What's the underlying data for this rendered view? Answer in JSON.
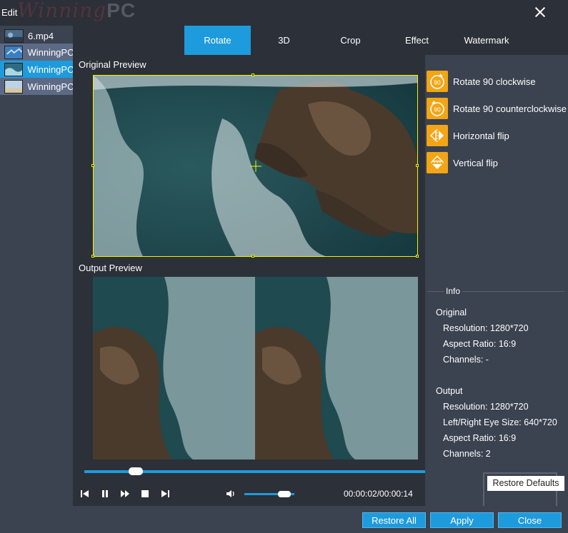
{
  "window": {
    "title": "Edit",
    "logo_text": "Winning",
    "logo_pc": "PC"
  },
  "files": [
    {
      "name": "6.mp4"
    },
    {
      "name": "WinningPC"
    },
    {
      "name": "WinningPC"
    },
    {
      "name": "WinningPC"
    }
  ],
  "tabs": [
    {
      "label": "Rotate"
    },
    {
      "label": "3D"
    },
    {
      "label": "Crop"
    },
    {
      "label": "Effect"
    },
    {
      "label": "Watermark"
    }
  ],
  "preview": {
    "original_label": "Original Preview",
    "output_label": "Output Preview",
    "progress_fraction": 0.15
  },
  "player": {
    "timecode": "00:00:02/00:00:14",
    "volume_fraction": 0.8
  },
  "rotate_actions": [
    {
      "label": "Rotate 90 clockwise",
      "icon": "rotate-clockwise-icon"
    },
    {
      "label": "Rotate 90 counterclockwise",
      "icon": "rotate-counterclockwise-icon"
    },
    {
      "label": "Horizontal flip",
      "icon": "horizontal-flip-icon"
    },
    {
      "label": "Vertical flip",
      "icon": "vertical-flip-icon"
    }
  ],
  "info": {
    "title": "Info",
    "original_heading": "Original",
    "original_resolution": "Resolution: 1280*720",
    "original_aspect": "Aspect Ratio: 16:9",
    "original_channels": "Channels: -",
    "output_heading": "Output",
    "output_resolution": "Resolution: 1280*720",
    "output_eye_size": "Left/Right Eye Size: 640*720",
    "output_aspect": "Aspect Ratio: 16:9",
    "output_channels": "Channels: 2"
  },
  "buttons": {
    "restore_defaults": "Restore Defaults",
    "restore_all": "Restore All",
    "apply": "Apply",
    "close": "Close"
  },
  "colors": {
    "accent": "#1e9bdc",
    "icon_orange": "#f3a514",
    "crop_border": "#f2f200",
    "panel_dark": "#2b3039",
    "panel": "#3b4250"
  }
}
